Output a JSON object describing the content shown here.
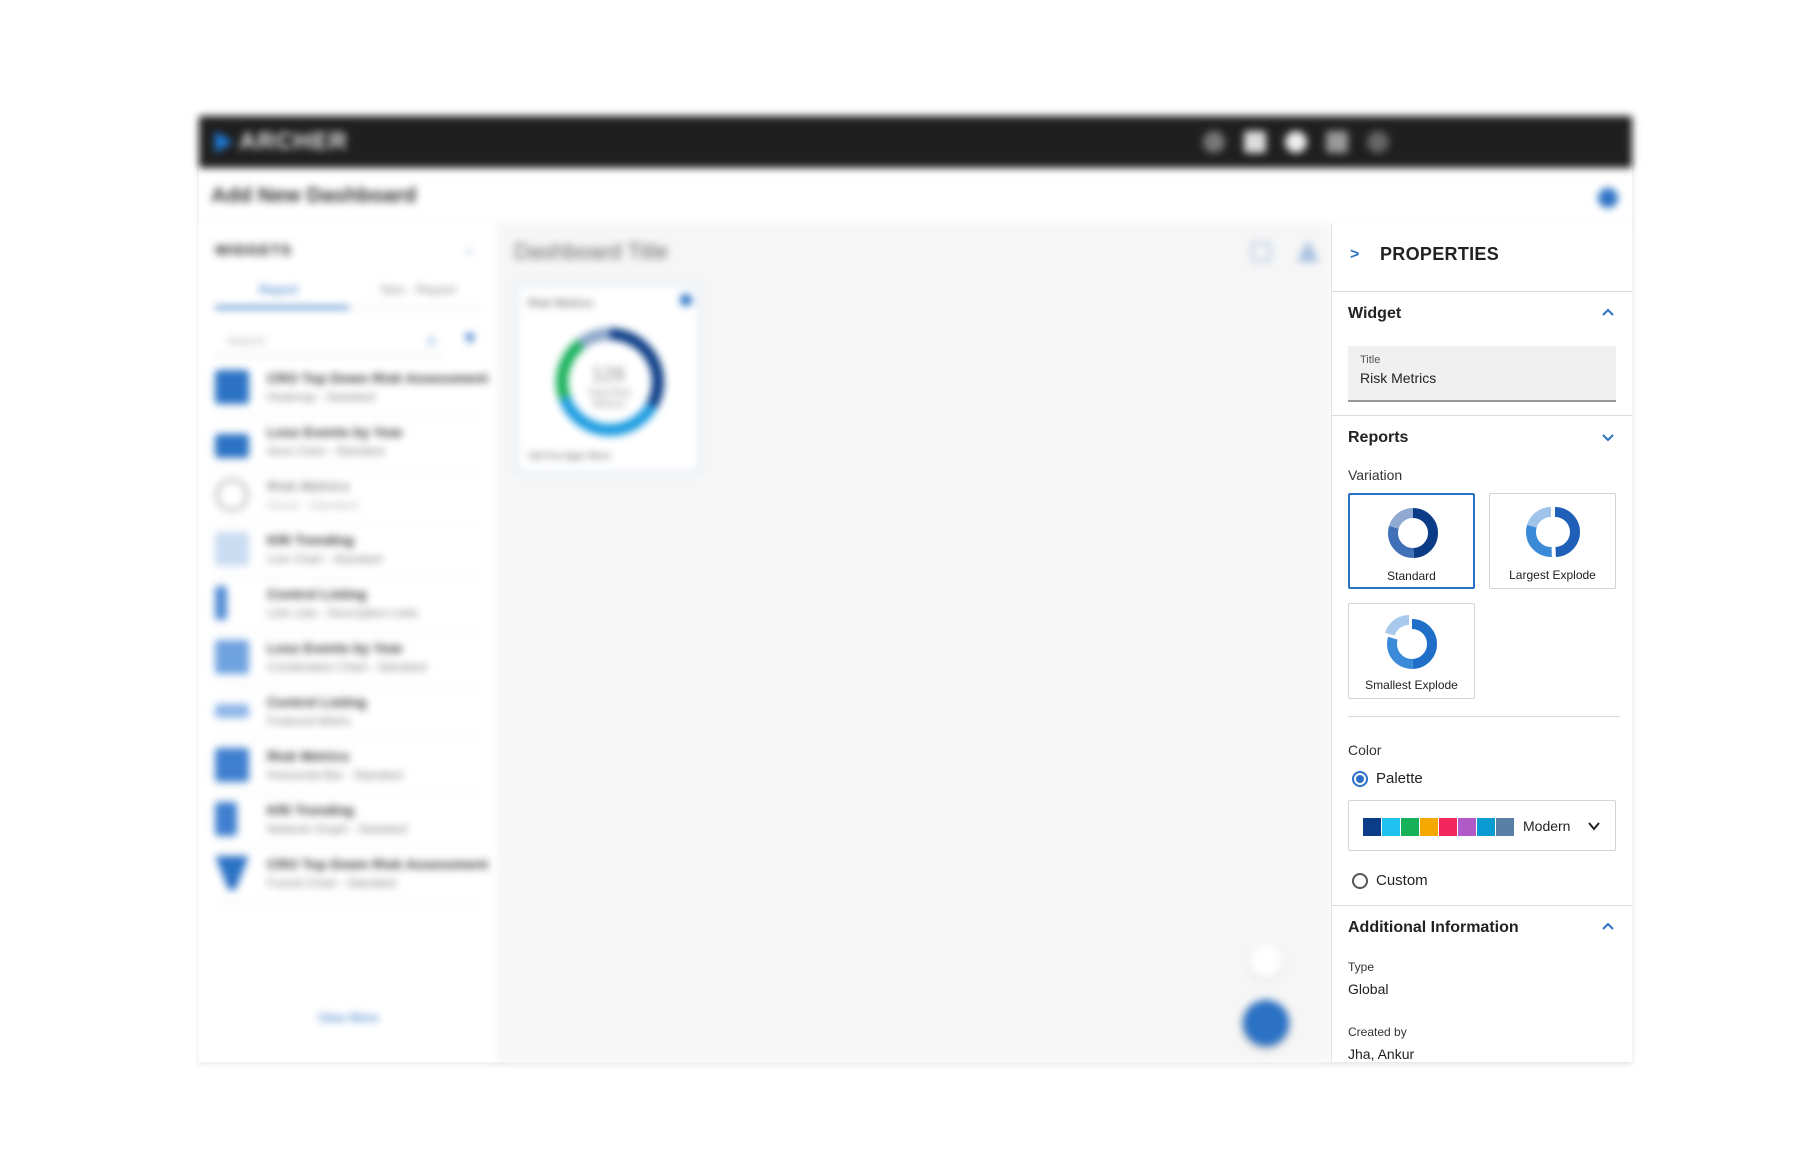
{
  "topbar": {
    "logo_text": "ARCHER"
  },
  "header": {
    "title": "Add New Dashboard"
  },
  "left_panel": {
    "section_label": "WIDGETS",
    "tabs": [
      "Report",
      "Non - Report"
    ],
    "search_placeholder": "Search",
    "items": [
      {
        "title": "CRO Top Down Risk Assessment",
        "subtitle": "Heatmap - Standard"
      },
      {
        "title": "Loss Events by Year",
        "subtitle": "Area Chart - Standard"
      },
      {
        "title": "Risk Metrics",
        "subtitle": "Donut - Standard"
      },
      {
        "title": "KRI Trending",
        "subtitle": "Line Chart - Standard"
      },
      {
        "title": "Control Listing",
        "subtitle": "Link Lists - Descriptive Links"
      },
      {
        "title": "Loss Events by Year",
        "subtitle": "Combination Chart - Standard"
      },
      {
        "title": "Control Listing",
        "subtitle": "Featured Metric"
      },
      {
        "title": "Risk Metrics",
        "subtitle": "Horizontal Bar - Standard"
      },
      {
        "title": "KRI Trending",
        "subtitle": "Network Graph - Standard"
      },
      {
        "title": "CRO Top Down Risk Assessment",
        "subtitle": "Funnel Chart - Standard"
      }
    ],
    "view_more": "View More"
  },
  "canvas": {
    "dashboard_title": "Dashboard Title",
    "widget": {
      "title": "Risk Metrics",
      "center_value": "128",
      "center_label": "Total Risk Metrics",
      "legend": "Val   Pos   Appr   More"
    }
  },
  "properties": {
    "title": "PROPERTIES",
    "widget_section": {
      "label": "Widget",
      "title_field_label": "Title",
      "title_field_value": "Risk Metrics"
    },
    "reports_section": {
      "label": "Reports",
      "variation_label": "Variation",
      "variations": [
        {
          "label": "Standard",
          "selected": true
        },
        {
          "label": "Largest Explode",
          "selected": false
        },
        {
          "label": "Smallest Explode",
          "selected": false
        }
      ],
      "color_label": "Color",
      "palette_option": "Palette",
      "palette_name": "Modern",
      "palette_colors": [
        "#0b3c87",
        "#1fc1ef",
        "#17b15a",
        "#f5a800",
        "#f2275d",
        "#b05ac7",
        "#0b9bd3",
        "#5a7fa6"
      ],
      "custom_option": "Custom"
    },
    "additional_section": {
      "label": "Additional Information",
      "type_label": "Type",
      "type_value": "Global",
      "created_label": "Created by",
      "created_value": "Jha, Ankur"
    }
  },
  "colors": {
    "accent": "#2b72c5",
    "topbar": "#1f1f1f"
  }
}
